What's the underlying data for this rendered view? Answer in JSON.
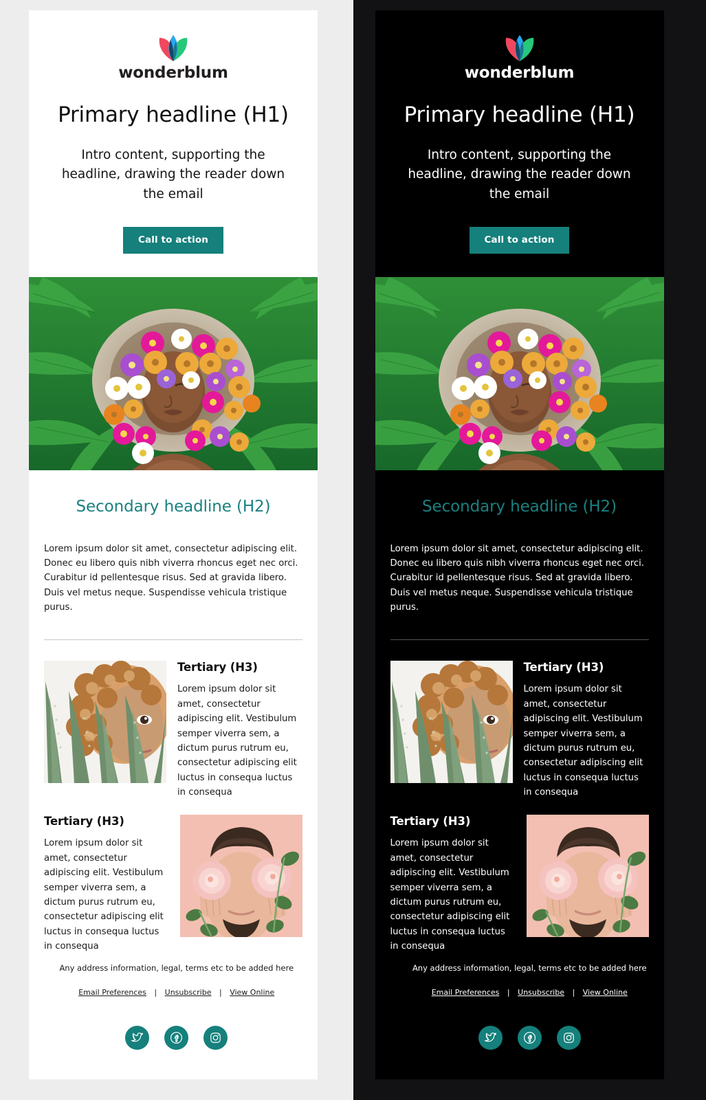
{
  "brand": {
    "name": "wonderblum",
    "logo_icon": "flower-petals-logo",
    "petal_colors": [
      "#f0485f",
      "#2aa8f2",
      "#27c878",
      "#123a52"
    ],
    "accent_color": "#15807c",
    "subhead_color": "#1a8080"
  },
  "email": {
    "headline": "Primary headline (H1)",
    "intro": "Intro content, supporting the headline, drawing the reader down the email",
    "cta_label": "Call to action",
    "hero_image_alt": "Woman lying among ferns with colourful flowers in her afro",
    "subheadline": "Secondary headline (H2)",
    "body_copy": "Lorem ipsum dolor sit amet, consectetur adipiscing elit. Donec eu libero quis nibh viverra rhoncus eget nec orci. Curabitur id pellentesque risus. Sed at gravida libero. Duis vel metus neque. Suspendisse vehicula tristique purus.",
    "tertiary": [
      {
        "title": "Tertiary (H3)",
        "copy": "Lorem ipsum dolor sit amet, consectetur adipiscing elit. Vestibulum semper viverra sem, a dictum purus rutrum eu, consectetur adipiscing elit luctus in consequa luctus in consequa",
        "image_alt": "Aloe vera leaves in front of a person with curly ginger hair",
        "image_side": "left"
      },
      {
        "title": "Tertiary (H3)",
        "copy": "Lorem ipsum dolor sit amet, consectetur adipiscing elit. Vestibulum semper viverra sem, a dictum purus rutrum eu, consectetur adipiscing elit luctus in consequa luctus in consequa",
        "image_alt": "Bearded man holding pink roses over his eyes on a pink background",
        "image_side": "right"
      }
    ]
  },
  "footer": {
    "address": "Any address information, legal, terms etc to be added here",
    "links": [
      {
        "label": "Email Preferences"
      },
      {
        "label": "Unsubscribe"
      },
      {
        "label": "View Online"
      }
    ],
    "separator": "|",
    "social": [
      {
        "name": "twitter-icon",
        "label": "Twitter"
      },
      {
        "name": "facebook-icon",
        "label": "Facebook"
      },
      {
        "name": "instagram-icon",
        "label": "Instagram"
      }
    ]
  },
  "variants": {
    "light": {
      "name": "Light theme email",
      "page_bg": "#ededed",
      "card_bg": "#ffffff"
    },
    "dark": {
      "name": "Dark theme email",
      "page_bg": "#121114",
      "card_bg": "#000000"
    }
  }
}
